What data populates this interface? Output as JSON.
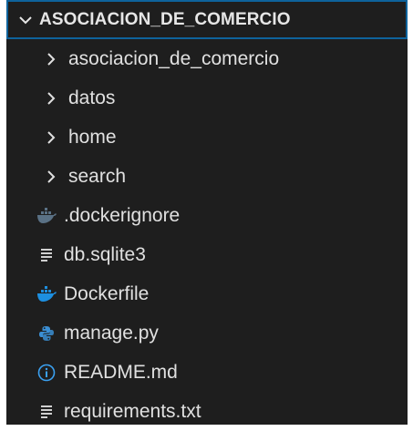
{
  "explorer": {
    "root": {
      "title": "ASOCIACION_DE_COMERCIO",
      "icon": "chevron-down-icon"
    },
    "items": [
      {
        "label": "asociacion_de_comercio",
        "kind": "folder",
        "icon": "chevron-right-icon"
      },
      {
        "label": "datos",
        "kind": "folder",
        "icon": "chevron-right-icon"
      },
      {
        "label": "home",
        "kind": "folder",
        "icon": "chevron-right-icon"
      },
      {
        "label": "search",
        "kind": "folder",
        "icon": "chevron-right-icon"
      },
      {
        "label": ".dockerignore",
        "kind": "file",
        "icon": "docker-icon-muted"
      },
      {
        "label": "db.sqlite3",
        "kind": "file",
        "icon": "text-lines-icon"
      },
      {
        "label": "Dockerfile",
        "kind": "file",
        "icon": "docker-icon"
      },
      {
        "label": "manage.py",
        "kind": "file",
        "icon": "python-icon"
      },
      {
        "label": "README.md",
        "kind": "file",
        "icon": "info-icon"
      },
      {
        "label": "requirements.txt",
        "kind": "file",
        "icon": "text-lines-icon"
      }
    ]
  },
  "colors": {
    "background": "#1e1e1e",
    "focus_border": "#0e639c",
    "text": "#e0e0e0",
    "docker": "#1d8fe0",
    "docker_muted": "#5a7185",
    "python": "#3b8fd4",
    "info": "#3aa0f0"
  }
}
